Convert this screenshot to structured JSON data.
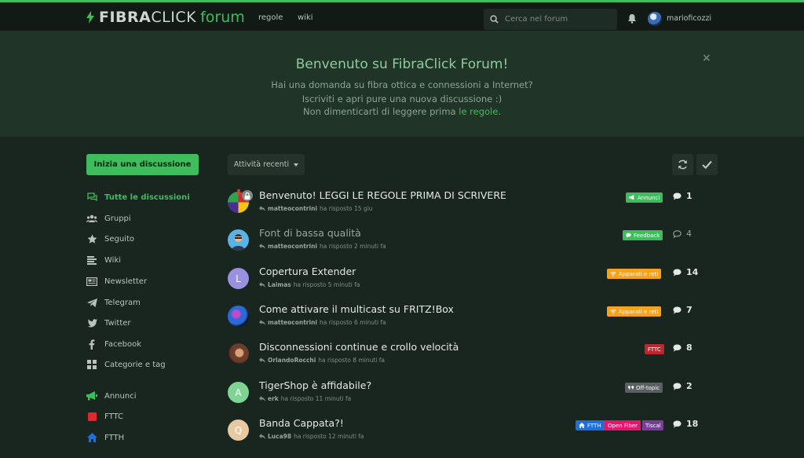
{
  "header": {
    "logo_bold": "FIBRA",
    "logo_light": "CLICK",
    "logo_forum": "forum",
    "nav": [
      "regole",
      "wiki"
    ],
    "search_placeholder": "Cerca nel forum",
    "username": "marioficozzi"
  },
  "hero": {
    "title": "Benvenuto su FibraClick Forum!",
    "line1": "Hai una domanda su fibra ottica e connessioni a Internet?",
    "line2": "Iscriviti e apri pure una nuova discussione :)",
    "line3_prefix": "Non dimenticarti di leggere prima ",
    "line3_link": "le regole",
    "line3_suffix": ".",
    "close": "×"
  },
  "sidebar": {
    "start_button": "Inizia una discussione",
    "items": [
      {
        "label": "Tutte le discussioni",
        "icon": "comments-icon"
      },
      {
        "label": "Gruppi",
        "icon": "users-icon"
      },
      {
        "label": "Seguito",
        "icon": "star-icon"
      },
      {
        "label": "Wiki",
        "icon": "list-icon"
      },
      {
        "label": "Newsletter",
        "icon": "newspaper-icon"
      },
      {
        "label": "Telegram",
        "icon": "telegram-icon"
      },
      {
        "label": "Twitter",
        "icon": "twitter-icon"
      },
      {
        "label": "Facebook",
        "icon": "facebook-icon"
      },
      {
        "label": "Categorie e tag",
        "icon": "grid-icon"
      },
      {
        "label": "Annunci",
        "icon": "megaphone-icon"
      },
      {
        "label": "FTTC",
        "icon": "square-tag-icon"
      },
      {
        "label": "FTTH",
        "icon": "home-icon"
      }
    ]
  },
  "toolbar": {
    "sort_label": "Attività recenti"
  },
  "discussions": [
    {
      "title": "Benvenuto! LEGGI LE REGOLE PRIMA DI SCRIVERE",
      "user": "matteocontrini",
      "action": "ha risposto",
      "time": "15 giu",
      "tag": "Annunci",
      "count": "1"
    },
    {
      "title": "Font di bassa qualità",
      "user": "matteocontrini",
      "action": "ha risposto",
      "time": "2 minuti fa",
      "tag": "Feedback",
      "count": "4"
    },
    {
      "title": "Copertura Extender",
      "user": "Laimas",
      "action": "ha risposto",
      "time": "5 minuti fa",
      "tag": "Apparati e reti",
      "count": "14",
      "avatar_letter": "L"
    },
    {
      "title": "Come attivare il multicast su FRITZ!Box",
      "user": "matteocontrini",
      "action": "ha risposto",
      "time": "6 minuti fa",
      "tag": "Apparati e reti",
      "count": "7"
    },
    {
      "title": "Disconnessioni continue e crollo velocità",
      "user": "OrlandoRocchi",
      "action": "ha risposto",
      "time": "8 minuti fa",
      "tag": "FTTC",
      "count": "8"
    },
    {
      "title": "TigerShop è affidabile?",
      "user": "erk",
      "action": "ha risposto",
      "time": "11 minuti fa",
      "tag": "Off-topic",
      "count": "2",
      "avatar_letter": "A"
    },
    {
      "title": "Banda Cappata?!",
      "user": "Luca98",
      "action": "ha risposto",
      "time": "12 minuti fa",
      "tags": [
        "FTTH",
        "Open Fiber",
        "Tiscal"
      ],
      "count": "18",
      "avatar_letter": "Q"
    }
  ],
  "colors": {
    "accent": "#3fbd5d",
    "annunci": "#3fbd5d",
    "feedback": "#3fbd5d",
    "apparati": "#f7a21b",
    "fttc": "#c0262d",
    "offtopic": "#5b5f63",
    "ftth": "#1e6fd9",
    "openfiber": "#e6156e",
    "tiscali": "#7a3d9a"
  }
}
